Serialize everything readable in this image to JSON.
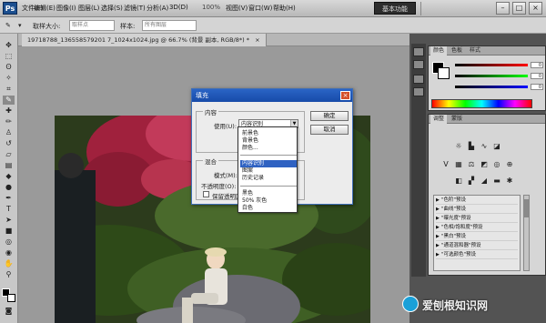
{
  "menubar": {
    "logo": "Ps",
    "items": [
      "文件(F)",
      "编辑(E)",
      "图像(I)",
      "图层(L)",
      "选择(S)",
      "滤镜(T)",
      "分析(A)",
      "3D(D)",
      "视图(V)",
      "窗口(W)",
      "帮助(H)"
    ],
    "zoom": "100%",
    "workspace": "基本功能"
  },
  "options": {
    "brush_size_label": "取样大小:",
    "brush_size_value": "取样点",
    "sample_label": "样本:",
    "sample_value": "所有图层"
  },
  "document": {
    "tab_title": "19718788_136558579201 7_1024x1024.jpg @ 66.7% (背景 副本, RGB/8*) *"
  },
  "fill_dialog": {
    "title": "填充",
    "content_legend": "内容",
    "use_label": "使用(U):",
    "use_value": "内容识别",
    "blend_legend": "混合",
    "mode_label": "模式(M):",
    "opacity_label": "不透明度(O):",
    "preserve_label": "保留透明区域(P)",
    "ok": "确定",
    "cancel": "取消"
  },
  "dropdown": {
    "items": [
      "前景色",
      "背景色",
      "颜色...",
      "内容识别",
      "图案",
      "历史记录",
      "黑色",
      "50% 灰色",
      "白色"
    ],
    "selected": "内容识别"
  },
  "right_panels": {
    "color_tabs": [
      "颜色",
      "色板",
      "样式"
    ],
    "slider_values": [
      "0",
      "0",
      "0"
    ],
    "adjust_tabs": [
      "调整",
      "蒙版"
    ],
    "presets": [
      "\"色阶\"预设",
      "\"曲线\"预设",
      "\"曝光度\"预设",
      "\"色相/饱和度\"预设",
      "\"黑白\"预设",
      "\"通道混和器\"预设",
      "\"可选颜色\"预设"
    ]
  },
  "watermark": "爱刨根知识网",
  "colors": {
    "accent": "#2f62c2",
    "dialog_title": "#174ba9"
  }
}
